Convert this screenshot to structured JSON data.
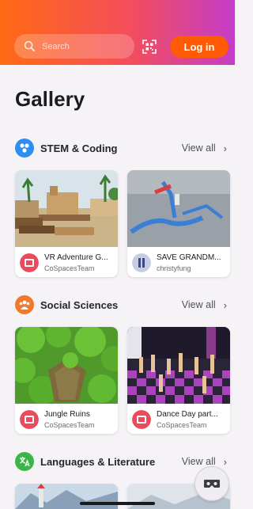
{
  "header": {
    "search_placeholder": "Search",
    "login_label": "Log in",
    "colors": {
      "gradient_start": "#ff6a14",
      "gradient_end": "#c43cc9",
      "login_bg": "#ff5a06"
    }
  },
  "page": {
    "title": "Gallery"
  },
  "sections": [
    {
      "title": "STEM & Coding",
      "icon": "atom-icon",
      "view_all": "View all",
      "cards": [
        {
          "title": "VR Adventure G...",
          "author": "CoSpacesTeam",
          "avatar": "cospaces-logo"
        },
        {
          "title": "SAVE GRANDM...",
          "author": "christyfung",
          "avatar": "user-avatar"
        }
      ]
    },
    {
      "title": "Social Sciences",
      "icon": "people-icon",
      "view_all": "View all",
      "cards": [
        {
          "title": "Jungle Ruins",
          "author": "CoSpacesTeam",
          "avatar": "cospaces-logo"
        },
        {
          "title": "Dance Day part...",
          "author": "CoSpacesTeam",
          "avatar": "cospaces-logo"
        }
      ]
    },
    {
      "title": "Languages & Literature",
      "icon": "translate-icon",
      "view_all": "View all",
      "cards": []
    }
  ],
  "floating": {
    "icon": "vr-headset-icon"
  }
}
